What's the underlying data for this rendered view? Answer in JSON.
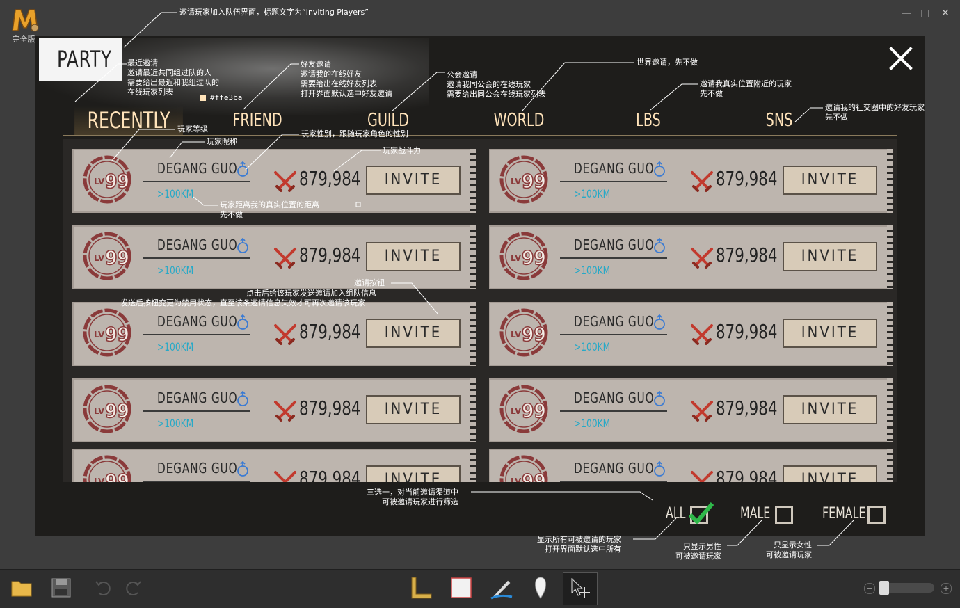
{
  "app": {
    "edition": "完全版"
  },
  "header": {
    "title": "PARTY"
  },
  "tabs": [
    {
      "label": "RECENTLY",
      "active": true
    },
    {
      "label": "FRIEND"
    },
    {
      "label": "GUILD"
    },
    {
      "label": "WORLD"
    },
    {
      "label": "LBS"
    },
    {
      "label": "SNS"
    }
  ],
  "player_card": {
    "level_prefix": "LV",
    "level": "99",
    "name": "DEGANG GUO",
    "distance": ">100KM",
    "power": "879,984",
    "invite_label": "INVITE"
  },
  "filters": {
    "all": {
      "label": "ALL",
      "checked": true
    },
    "male": {
      "label": "MALE",
      "checked": false
    },
    "female": {
      "label": "FEMALE",
      "checked": false
    }
  },
  "colors": {
    "tab_text": "#ffe3ba",
    "distance": "#27a9c7",
    "level_ring": "#8a3a3a",
    "check": "#2fb84a",
    "card_bg": "#bdb5ae"
  },
  "annotations": {
    "title_note": "邀请玩家加入队伍界面，标题文字为“Inviting Players”",
    "recently_note": "最近邀请\n邀请最近共同组过队的人\n需要给出最近和我组过队的\n在线玩家列表",
    "color_note": "#ffe3ba",
    "friend_note": "好友邀请\n邀请我的在线好友\n需要给出在线好友列表\n打开界面默认选中好友邀请",
    "guild_note": "公会邀请\n邀请我同公会的在线玩家\n需要给出同公会在线玩家列表",
    "world_note": "世界邀请，先不做",
    "lbs_note": "邀请我真实位置附近的玩家\n先不做",
    "sns_note": "邀请我的社交圈中的好友玩家\n先不做",
    "level_note": "玩家等级",
    "nickname_note": "玩家昵称",
    "gender_note": "玩家性别，跟随玩家角色的性别",
    "power_note": "玩家战斗力",
    "distance_note": "玩家距离我的真实位置的距离\n先不做",
    "invite_note_title": "邀请按钮",
    "invite_note_line1": "点击后给该玩家发送邀请加入组队信息",
    "invite_note_line2": "发送后按钮变更为禁用状态，直至该条邀请信息失效才可再次邀请该玩家",
    "filter_note": "三选一，对当前邀请渠道中\n可被邀请玩家进行筛选",
    "all_note": "显示所有可被邀请的玩家\n打开界面默认选中所有",
    "male_note": "只显示男性\n可被邀请玩家",
    "female_note": "只显示女性\n可被邀请玩家"
  }
}
